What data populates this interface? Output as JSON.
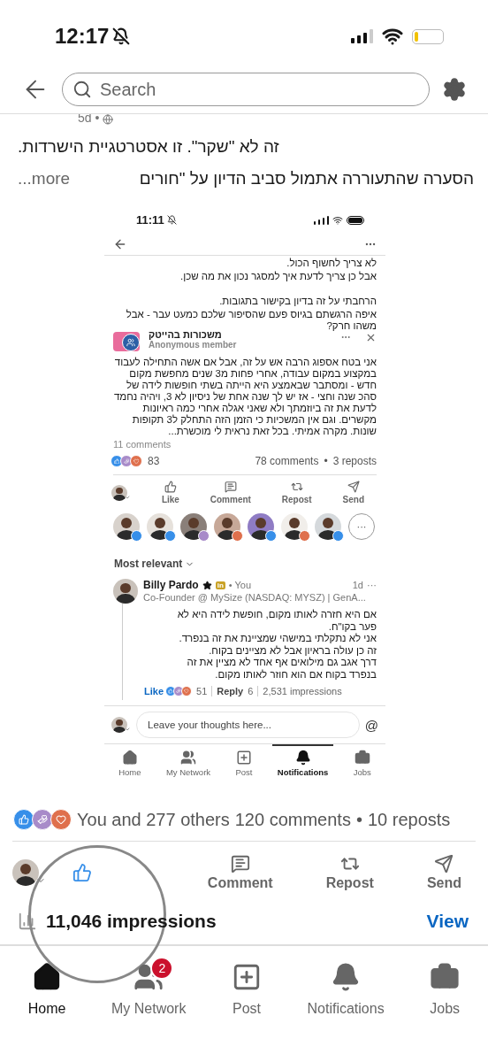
{
  "status_bar": {
    "time": "12:17",
    "silenced": true
  },
  "search": {
    "placeholder": "Search"
  },
  "post": {
    "meta": "5d •",
    "lines": [
      "זה לא \"שקר\". זו אסטרטגיית הישרדות.",
      "הסערה שהתעוררה אתמול סביב הדיון על \"חורים"
    ],
    "more": "...more"
  },
  "embedded": {
    "status_time": "11:11",
    "intro": [
      [
        "לא צריך לחשוף הכול.",
        "אבל כן צריך לדעת איך למסגר נכון את מה שכן."
      ],
      [
        "הרחבתי על זה בדיון בקישור בתגובות.",
        "איפה הרגשתם בגיוס פעם שהסיפור שלכם כמעט עבר - אבל משהו חרק?"
      ]
    ],
    "group": {
      "name": "משכורות בהייטק",
      "member": "Anonymous member",
      "body": "אני בטח אספוג הרבה אש על זה, אבל אם אשה  התחילה לעבוד במקצוע במקום עבודה, אחרי פחות מ3 שנים מחפשת מקום חדש - ומסתבר שבאמצע היא הייתה בשתי חופשות לידה של סהכ שנה וחצי - אז יש לך שנה אחת של ניסיון לא 3, ויהיה נחמד  לדעת את זה ביוזמתך ולא שאני אגלה אחרי כמה ראיונות מקשרים. וגם אין המשכיות כי הזמן הזה התחלק ל3 תקופות שונות. מקרה אמיתי. בכל זאת נראית לי מוכשרת...",
      "comments": "11 comments"
    },
    "stats": {
      "reactions": "83",
      "comments": "78 comments",
      "sep": "•",
      "reposts": "3 reposts"
    },
    "actions": {
      "like": "Like",
      "comment": "Comment",
      "repost": "Repost",
      "send": "Send"
    },
    "reactors": [
      {
        "kind": "like"
      },
      {
        "kind": "like"
      },
      {
        "kind": "support"
      },
      {
        "kind": "heart"
      },
      {
        "kind": "like"
      },
      {
        "kind": "heart"
      },
      {
        "kind": "like"
      }
    ],
    "more_reactors": "···",
    "sort": "Most relevant",
    "comment": {
      "name": "Billy Pardo",
      "badge": "in",
      "you": "• You",
      "time": "1d",
      "menu": "···",
      "headline": "Co-Founder @ MySize (NASDAQ: MYSZ) | GenA...",
      "lines": [
        "אם היא חזרה לאותו מקום, חופשת לידה היא לא פער בקו\"ח.",
        "אני לא נתקלתי במישהי שמציינת את זה בנפרד.",
        "זה כן עולה בראיון אבל לא מציינים בקוח.",
        "דרך אגב גם מילואים אף אחד לא מציין את זה בנפרד בקוח אם הוא חוזר לאותו מקום."
      ],
      "like": "Like",
      "reaction_count": "51",
      "reply": "Reply",
      "reply_count": "6",
      "impressions": "2,531 impressions"
    },
    "input": {
      "placeholder": "Leave your thoughts here...",
      "at": "@"
    },
    "nav": {
      "home": {
        "label": "Home",
        "selected": false
      },
      "network": {
        "label": "My Network",
        "selected": false
      },
      "post": {
        "label": "Post",
        "selected": false
      },
      "bell": {
        "label": "Notifications",
        "selected": true
      },
      "jobs": {
        "label": "Jobs",
        "selected": false
      }
    }
  },
  "stats": {
    "reactions": "You and 277 others",
    "comments": "120 comments",
    "sep": "•",
    "reposts": "10 reposts"
  },
  "actions": {
    "comment": "Comment",
    "repost": "Repost",
    "send": "Send"
  },
  "impressions": {
    "text": "11,046 impressions",
    "link": "View"
  },
  "nav": {
    "home": {
      "label": "Home",
      "selected": true
    },
    "network": {
      "label": "My Network",
      "selected": false,
      "badge": "2"
    },
    "post": {
      "label": "Post",
      "selected": false
    },
    "bell": {
      "label": "Notifications",
      "selected": false
    },
    "jobs": {
      "label": "Jobs",
      "selected": false
    }
  }
}
